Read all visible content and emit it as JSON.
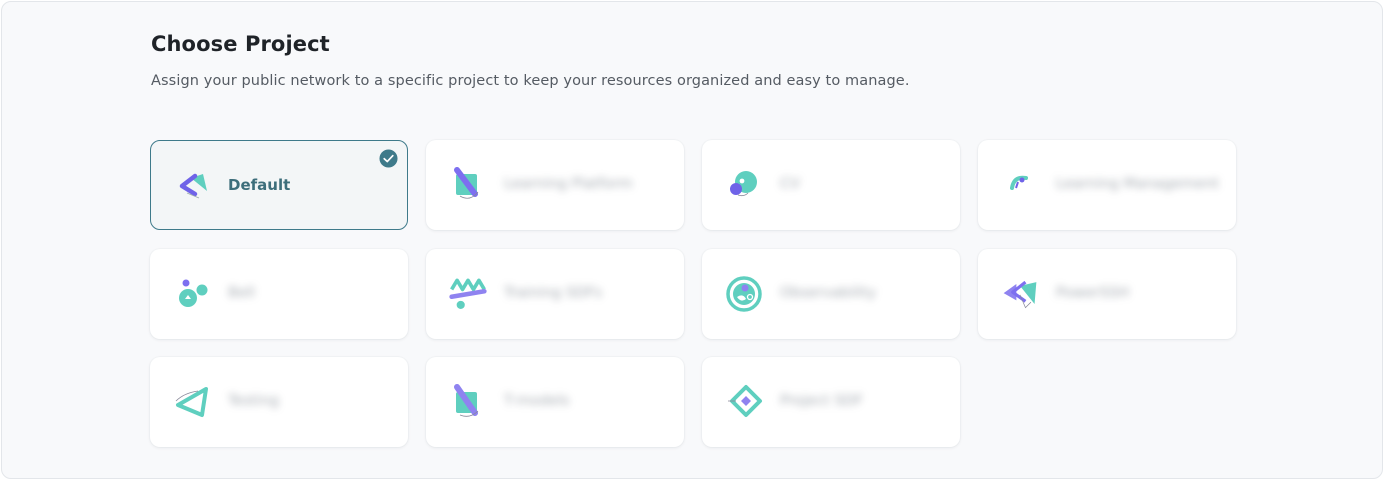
{
  "header": {
    "title": "Choose Project",
    "subtitle": "Assign your public network to a specific project to keep your resources organized and easy to manage."
  },
  "projects": [
    {
      "label": "Default",
      "icon": "arrow-shapes-icon",
      "selected": true
    },
    {
      "label": "Learning Platform",
      "icon": "square-slash-icon",
      "selected": false
    },
    {
      "label": "CV",
      "icon": "circles-icon",
      "selected": false
    },
    {
      "label": "Learning Management",
      "icon": "small-shape-icon",
      "selected": false
    },
    {
      "label": "Bell",
      "icon": "bubbles-icon",
      "selected": false
    },
    {
      "label": "Training SDFs",
      "icon": "zigzag-icon",
      "selected": false
    },
    {
      "label": "Observability",
      "icon": "ring-icon",
      "selected": false
    },
    {
      "label": "PowerSSH",
      "icon": "double-arrow-icon",
      "selected": false
    },
    {
      "label": "Testing",
      "icon": "triangle-icon",
      "selected": false
    },
    {
      "label": "T-models",
      "icon": "square-slash-icon",
      "selected": false
    },
    {
      "label": "Project SDF",
      "icon": "diamond-icon",
      "selected": false
    }
  ],
  "colors": {
    "accent": "#3e7a8a",
    "teal": "#5fcfbf",
    "purple": "#8f83f0",
    "selected_bg": "#f3f6f7"
  }
}
